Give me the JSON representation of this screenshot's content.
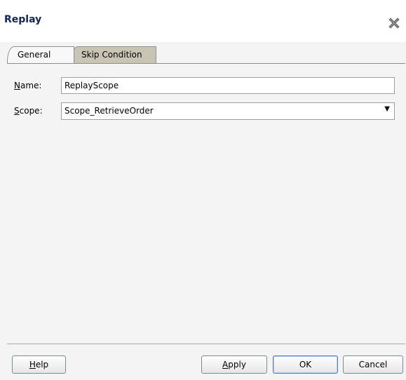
{
  "dialog": {
    "title": "Replay",
    "close_icon": "close-x-icon"
  },
  "tabs": [
    {
      "label": "General",
      "selected": true
    },
    {
      "label": "Skip Condition",
      "selected": false
    }
  ],
  "form": {
    "name_label_mnemonic": "N",
    "name_label_rest": "ame:",
    "name_value": "ReplayScope",
    "scope_label_mnemonic": "S",
    "scope_label_rest": "cope:",
    "scope_value": "Scope_RetrieveOrder"
  },
  "buttons": {
    "help_mnemonic": "H",
    "help_rest": "elp",
    "apply_mnemonic": "A",
    "apply_rest": "pply",
    "ok": "OK",
    "cancel": "Cancel"
  },
  "colors": {
    "title": "#13245a",
    "inactive_tab": "#c9c5b4",
    "panel": "#f4f4f4"
  }
}
